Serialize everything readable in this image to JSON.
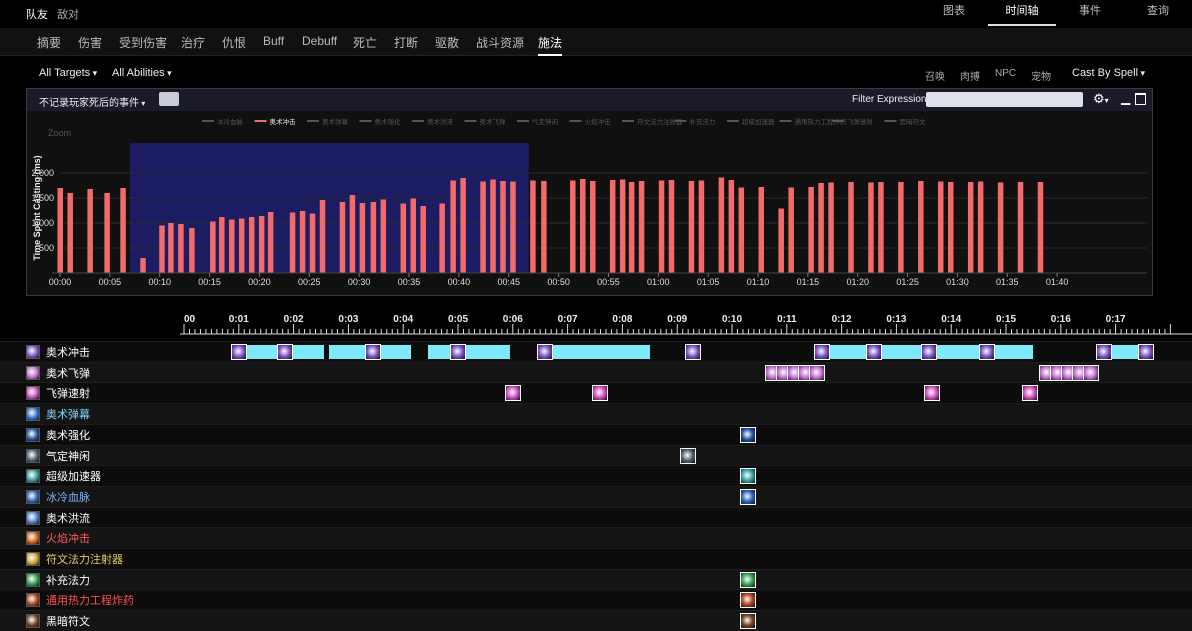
{
  "top": {
    "left_active": "队友",
    "left_other": "敌对",
    "tabs": [
      {
        "label": "图表"
      },
      {
        "label": "时间轴"
      },
      {
        "label": "事件"
      },
      {
        "label": "查询"
      }
    ]
  },
  "subtabs": [
    "摘要",
    "伤害",
    "受到伤害",
    "治疗",
    "仇恨",
    "Buff",
    "Debuff",
    "死亡",
    "打断",
    "驱散",
    "战斗资源",
    "施法"
  ],
  "filters": {
    "targets": "All Targets",
    "abilities": "All Abilities",
    "right": [
      "召唤",
      "肉搏",
      "NPC",
      "宠物"
    ],
    "cast_by": "Cast By Spell"
  },
  "panel": {
    "dropdown": "不记录玩家死后的事件",
    "filter_label": "Filter Expression:",
    "filter_value": ""
  },
  "chart_data": {
    "type": "bar",
    "ylabel": "Time Spent Casting (ms)",
    "zoom_label": "Zoom",
    "ylim": [
      0,
      2600
    ],
    "yticks": [
      500,
      1000,
      1500,
      2000
    ],
    "ytick_labels": [
      "500",
      "1,000",
      "1,500",
      "2,000"
    ],
    "xlim": [
      0,
      106
    ],
    "xticks": [
      0,
      5,
      10,
      15,
      20,
      25,
      30,
      35,
      40,
      45,
      50,
      55,
      60,
      65,
      70,
      75,
      80,
      85,
      90,
      95,
      100
    ],
    "xtick_labels": [
      "00:00",
      "00:05",
      "00:10",
      "00:15",
      "00:20",
      "00:25",
      "00:30",
      "00:35",
      "00:40",
      "00:45",
      "00:50",
      "00:55",
      "01:00",
      "01:05",
      "01:10",
      "01:15",
      "01:20",
      "01:25",
      "01:30",
      "01:35",
      "01:40"
    ],
    "legend": [
      "冰冷血脉",
      "奥术冲击",
      "奥术弹幕",
      "奥术强化",
      "奥术洪流",
      "奥术飞弹",
      "气定神闲",
      "火焰冲击",
      "符文法力注射器",
      "补充法力",
      "超级加速器",
      "通用热力工程炸药",
      "飞弹速射",
      "黑暗符文"
    ],
    "legend_active": "奥术冲击",
    "highlight": [
      7,
      47
    ],
    "series": [
      {
        "name": "奥术冲击",
        "color": "#f26a6a",
        "x": [
          0,
          1,
          3,
          4.7,
          6.3,
          8.3,
          10.2,
          11.1,
          12.1,
          13.2,
          15.3,
          16.2,
          17.2,
          18.2,
          19.2,
          20.2,
          21.1,
          23.3,
          24.3,
          25.3,
          26.3,
          28.3,
          29.3,
          30.3,
          31.4,
          32.4,
          34.4,
          35.4,
          36.4,
          38.3,
          39.4,
          40.4,
          42.4,
          43.4,
          44.4,
          45.4,
          47.4,
          48.5,
          51.4,
          52.4,
          53.4,
          55.4,
          56.4,
          57.3,
          58.3,
          60.3,
          61.3,
          63.3,
          64.3,
          66.3,
          67.3,
          68.3,
          70.3,
          72.3,
          73.3,
          75.3,
          76.3,
          77.3,
          79.3,
          81.3,
          82.3,
          84.3,
          86.3,
          88.3,
          89.3,
          91.3,
          92.3,
          94.3,
          96.3,
          98.3
        ],
        "values": [
          1700,
          1600,
          1680,
          1600,
          1700,
          300,
          950,
          1000,
          980,
          900,
          1030,
          1120,
          1070,
          1090,
          1120,
          1140,
          1220,
          1210,
          1240,
          1190,
          1460,
          1420,
          1560,
          1400,
          1420,
          1470,
          1390,
          1490,
          1340,
          1390,
          1850,
          1900,
          1830,
          1870,
          1840,
          1830,
          1850,
          1840,
          1850,
          1880,
          1840,
          1860,
          1870,
          1820,
          1840,
          1850,
          1860,
          1840,
          1850,
          1910,
          1860,
          1710,
          1720,
          1290,
          1710,
          1720,
          1800,
          1810,
          1820,
          1810,
          1820,
          1820,
          1840,
          1830,
          1820,
          1820,
          1830,
          1810,
          1820,
          1820
        ]
      }
    ]
  },
  "ruler": {
    "labels": [
      "00",
      "0:01",
      "0:02",
      "0:03",
      "0:04",
      "0:05",
      "0:06",
      "0:07",
      "0:08",
      "0:09",
      "0:10",
      "0:11",
      "0:12",
      "0:13",
      "0:14",
      "0:15",
      "0:16",
      "0:17"
    ]
  },
  "spells": [
    {
      "name": "奥术冲击",
      "color": "#ffffff",
      "icon": "arcane-blast-icon",
      "icon_color": "#7a52c8"
    },
    {
      "name": "奥术飞弹",
      "color": "#ffffff",
      "icon": "arcane-missiles-icon",
      "icon_color": "#c070d0"
    },
    {
      "name": "飞弹速射",
      "color": "#ffffff",
      "icon": "missile-barrage-icon",
      "icon_color": "#d050c0"
    },
    {
      "name": "奥术弹幕",
      "color": "#7fd8ff",
      "icon": "arcane-barrage-icon",
      "icon_color": "#3070d0"
    },
    {
      "name": "奥术强化",
      "color": "#ffffff",
      "icon": "arcane-power-icon",
      "icon_color": "#2050a0"
    },
    {
      "name": "气定神闲",
      "color": "#ffffff",
      "icon": "presence-of-mind-icon",
      "icon_color": "#506070"
    },
    {
      "name": "超级加速器",
      "color": "#ffffff",
      "icon": "hyperspeed-icon",
      "icon_color": "#3aa0a0"
    },
    {
      "name": "冰冷血脉",
      "color": "#7fb0ff",
      "icon": "icy-veins-icon",
      "icon_color": "#2a60c0"
    },
    {
      "name": "奥术洪流",
      "color": "#ffffff",
      "icon": "arcane-torrent-icon",
      "icon_color": "#5080d0"
    },
    {
      "name": "火焰冲击",
      "color": "#ff5a5a",
      "icon": "fire-blast-icon",
      "icon_color": "#d06020"
    },
    {
      "name": "符文法力注射器",
      "color": "#e0d060",
      "icon": "mana-injector-icon",
      "icon_color": "#d0a030"
    },
    {
      "name": "补充法力",
      "color": "#ffffff",
      "icon": "mana-potion-icon",
      "icon_color": "#30a050"
    },
    {
      "name": "通用热力工程炸药",
      "color": "#ff5050",
      "icon": "explosive-icon",
      "icon_color": "#b04020"
    },
    {
      "name": "黑暗符文",
      "color": "#ffffff",
      "icon": "dark-rune-icon",
      "icon_color": "#704020"
    }
  ],
  "casts": [
    {
      "row": 0,
      "icons": [
        0.85,
        1.7,
        3.3,
        4.85,
        6.45,
        9.15,
        11.5,
        12.45,
        13.45,
        14.5,
        16.65,
        17.4
      ],
      "bars": [
        [
          1.05,
          2.55
        ],
        [
          2.65,
          4.15
        ],
        [
          4.45,
          5.95
        ],
        [
          6.7,
          8.5
        ],
        [
          11.75,
          12.5
        ],
        [
          12.7,
          13.5
        ],
        [
          13.7,
          14.5
        ],
        [
          14.75,
          15.5
        ],
        [
          16.85,
          17.6
        ]
      ]
    },
    {
      "row": 1,
      "icons": [
        10.6,
        10.8,
        11.0,
        11.2,
        11.4,
        15.6,
        15.8,
        16.0,
        16.2,
        16.4
      ],
      "bars": []
    },
    {
      "row": 2,
      "icons": [
        5.85,
        7.45,
        13.5,
        15.3
      ],
      "bars": []
    },
    {
      "row": 4,
      "icons": [
        10.15
      ],
      "bars": []
    },
    {
      "row": 5,
      "icons": [
        9.05
      ],
      "bars": []
    },
    {
      "row": 6,
      "icons": [
        10.15
      ],
      "bars": []
    },
    {
      "row": 7,
      "icons": [
        10.15
      ],
      "bars": []
    },
    {
      "row": 11,
      "icons": [
        10.15
      ],
      "bars": []
    },
    {
      "row": 12,
      "icons": [
        10.15
      ],
      "bars": []
    },
    {
      "row": 13,
      "icons": [
        10.15
      ],
      "bars": []
    }
  ]
}
